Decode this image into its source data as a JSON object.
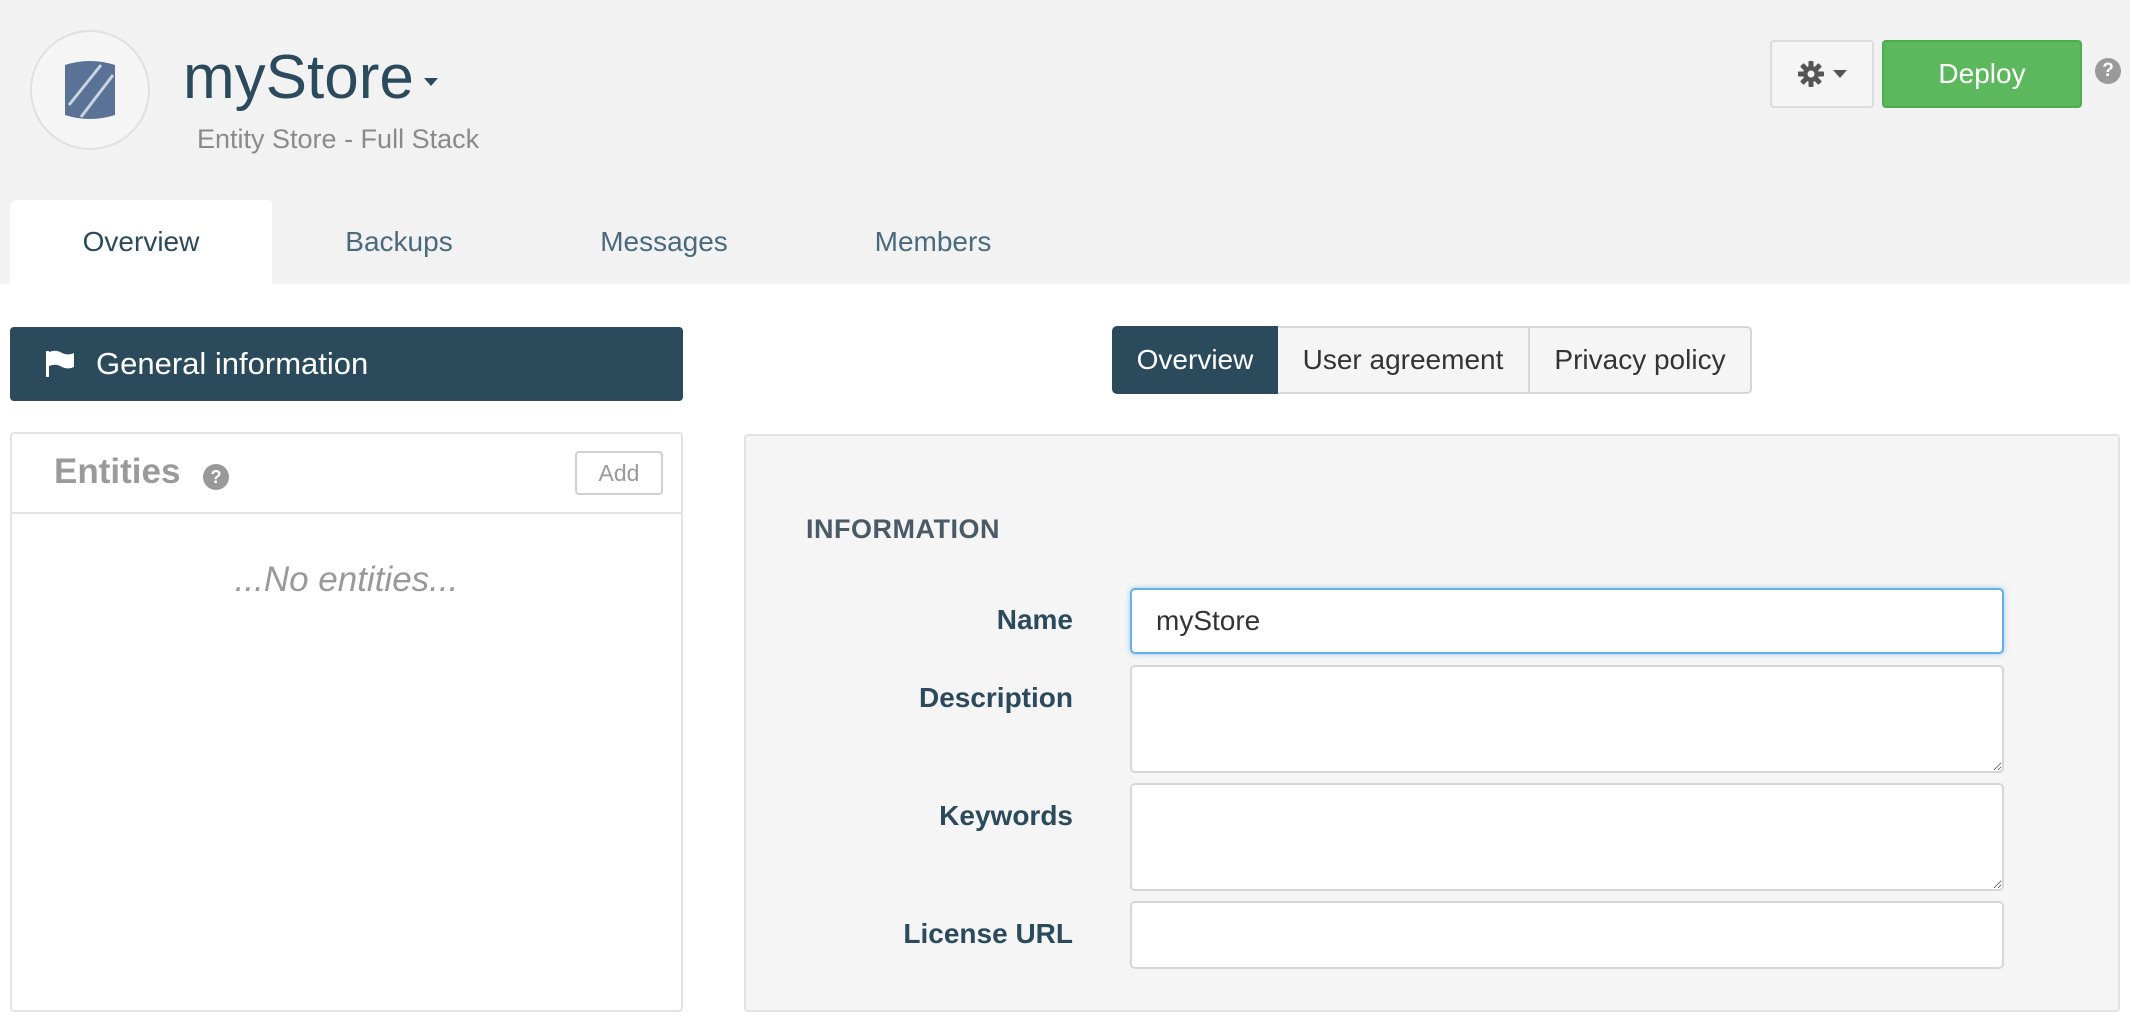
{
  "header": {
    "app_name": "myStore",
    "subtitle": "Entity Store - Full Stack",
    "settings_icon": "gear-icon",
    "deploy_label": "Deploy",
    "help_icon": "?",
    "brand_color": "#2b4a5c",
    "deploy_color": "#5cb85c"
  },
  "tabs": [
    {
      "label": "Overview",
      "active": true
    },
    {
      "label": "Backups",
      "active": false
    },
    {
      "label": "Messages",
      "active": false
    },
    {
      "label": "Members",
      "active": false
    }
  ],
  "sidebar": {
    "general_info_label": "General information",
    "entities": {
      "title": "Entities",
      "help_icon": "?",
      "add_label": "Add",
      "empty_text": "...No entities..."
    }
  },
  "content_tabs": [
    {
      "label": "Overview",
      "active": true
    },
    {
      "label": "User agreement",
      "active": false
    },
    {
      "label": "Privacy policy",
      "active": false
    }
  ],
  "form": {
    "heading": "INFORMATION",
    "name_label": "Name",
    "name_value": "myStore",
    "description_label": "Description",
    "description_value": "",
    "keywords_label": "Keywords",
    "keywords_value": "",
    "license_label": "License URL",
    "license_value": ""
  }
}
